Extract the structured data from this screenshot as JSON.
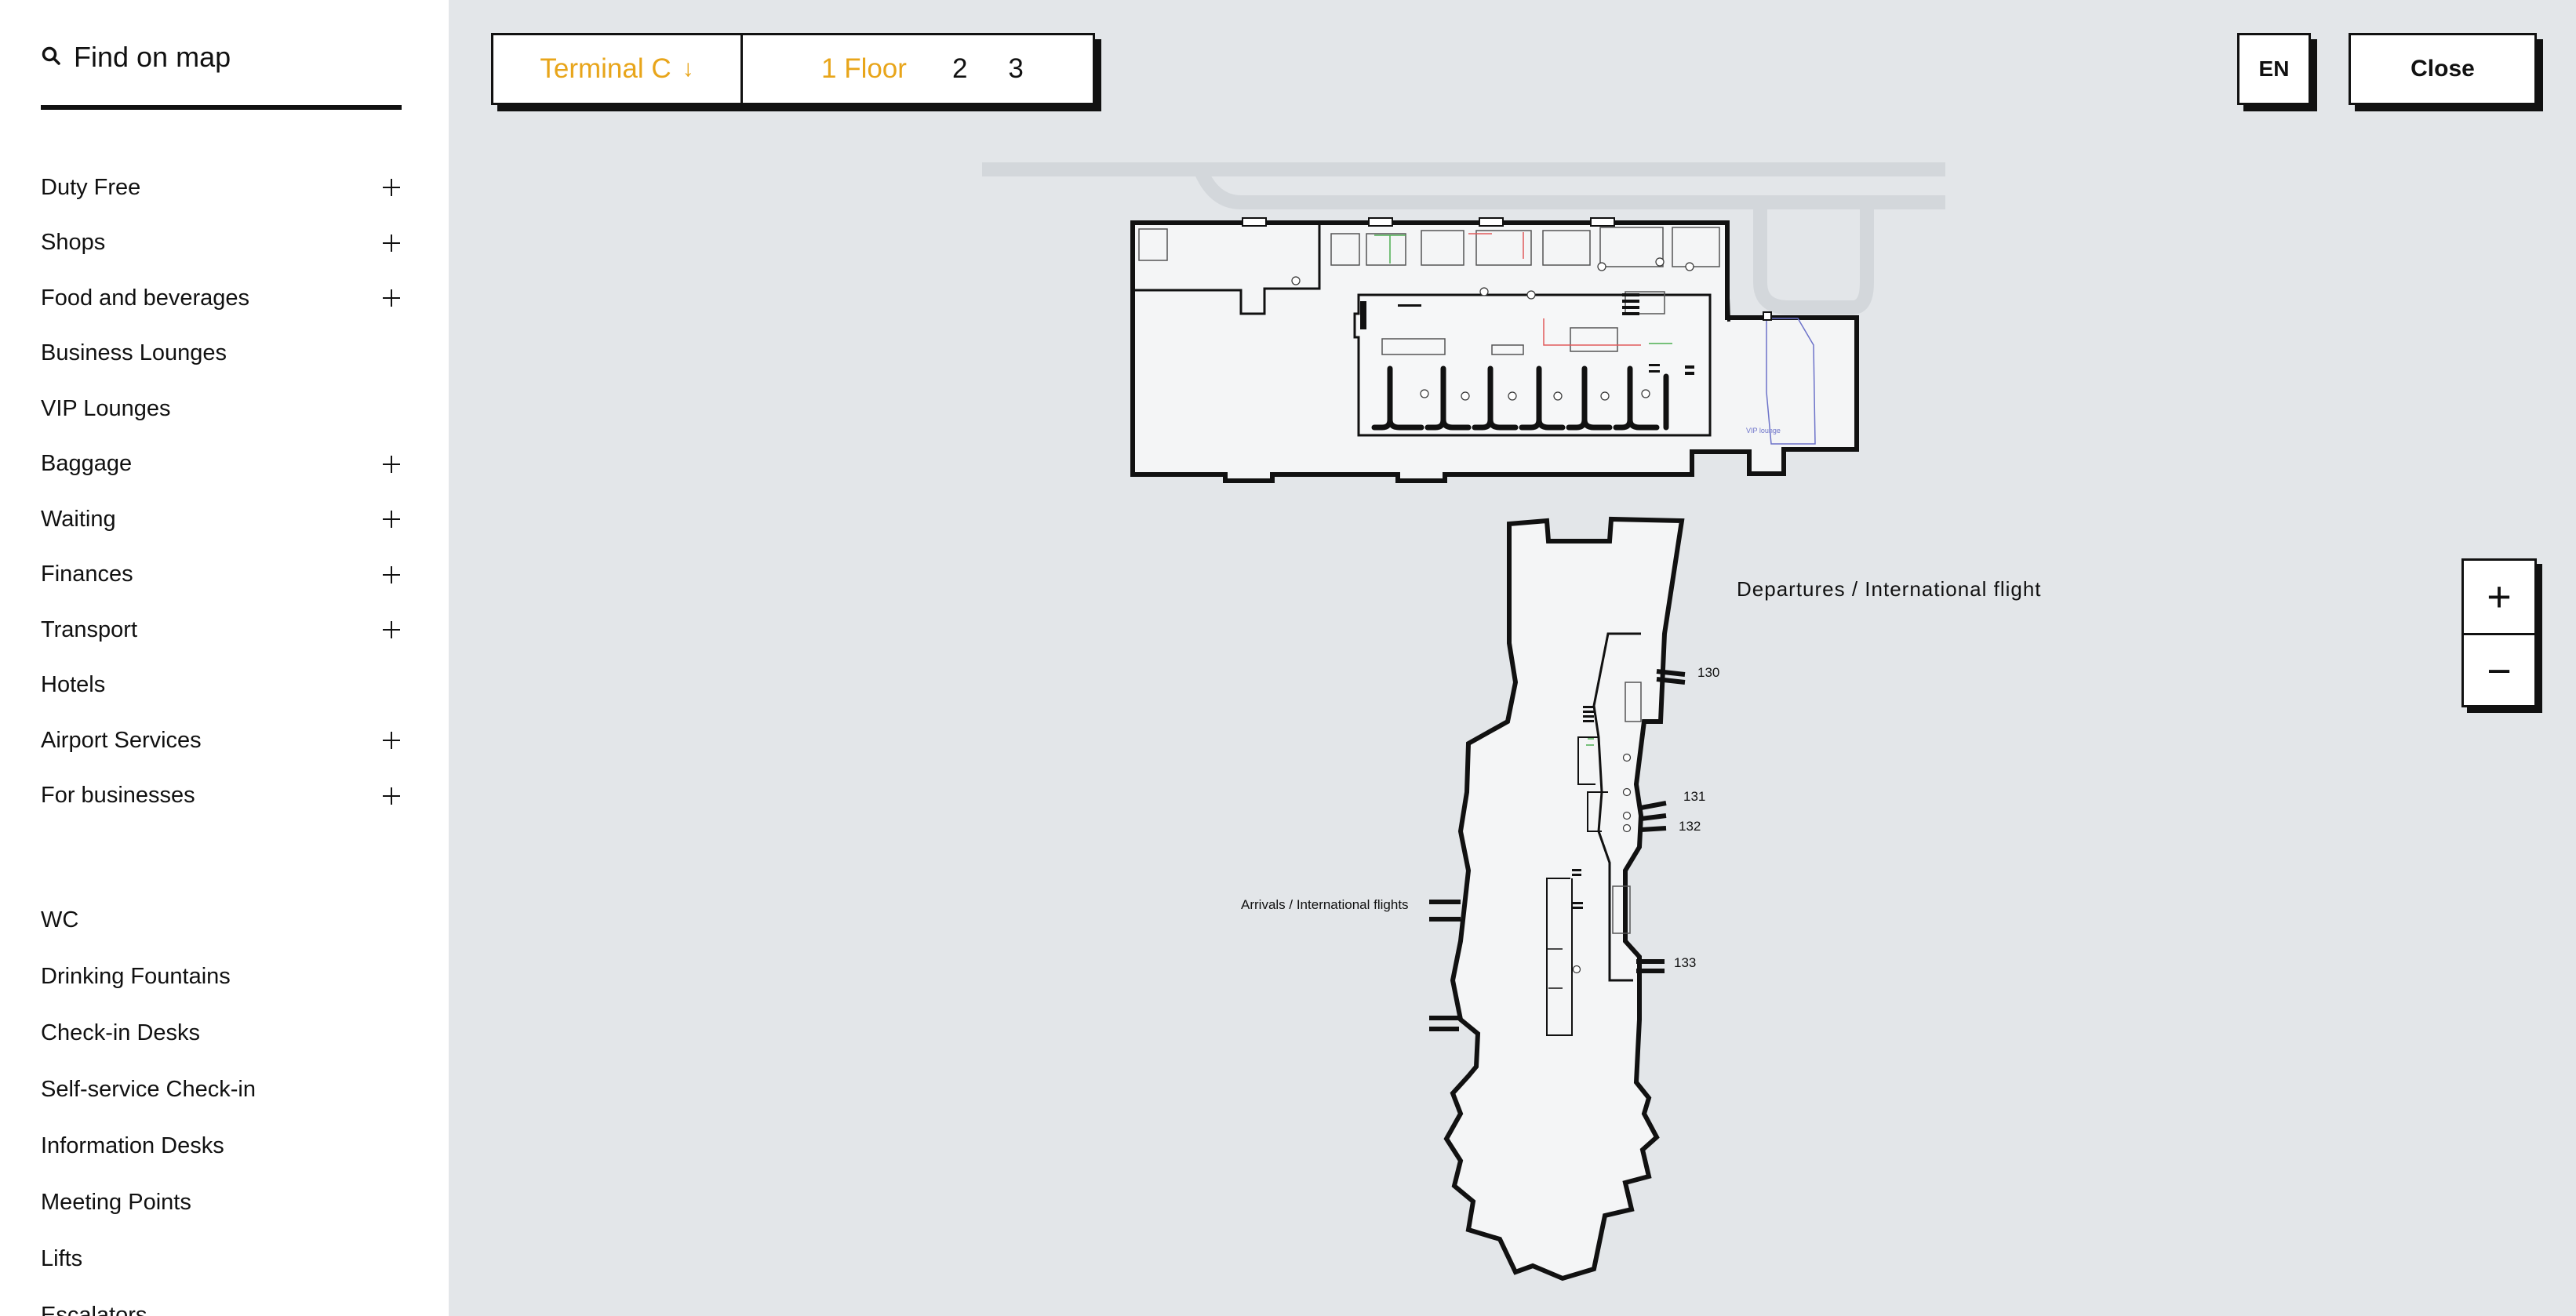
{
  "search": {
    "label": "Find on map",
    "icon": "search-icon"
  },
  "categories": [
    {
      "label": "Duty Free",
      "expandable": true
    },
    {
      "label": "Shops",
      "expandable": true
    },
    {
      "label": "Food and beverages",
      "expandable": true
    },
    {
      "label": "Business Lounges",
      "expandable": false
    },
    {
      "label": "VIP Lounges",
      "expandable": false
    },
    {
      "label": "Baggage",
      "expandable": true
    },
    {
      "label": "Waiting",
      "expandable": true
    },
    {
      "label": "Finances",
      "expandable": true
    },
    {
      "label": "Transport",
      "expandable": true
    },
    {
      "label": "Hotels",
      "expandable": false
    },
    {
      "label": "Airport Services",
      "expandable": true
    },
    {
      "label": "For businesses",
      "expandable": true
    }
  ],
  "amenities": [
    "WC",
    "Drinking Fountains",
    "Check-in Desks",
    "Self-service Check-in",
    "Information Desks",
    "Meeting Points",
    "Lifts",
    "Escalators"
  ],
  "terminal": {
    "label": "Terminal C",
    "arrow": "↓"
  },
  "floors": {
    "active": "1 Floor",
    "others": [
      "2",
      "3"
    ]
  },
  "language": "EN",
  "close_label": "Close",
  "zoom": {
    "in": "+",
    "out": "−"
  },
  "map": {
    "labels": {
      "departures": "Departures / International flight",
      "arrivals": "Arrivals / International flights",
      "vip_lounge": "VIP lounge"
    },
    "gates": [
      "130",
      "131",
      "132",
      "133"
    ]
  },
  "colors": {
    "accent": "#e8a51a",
    "background": "#e3e6e9",
    "ink": "#111111"
  }
}
